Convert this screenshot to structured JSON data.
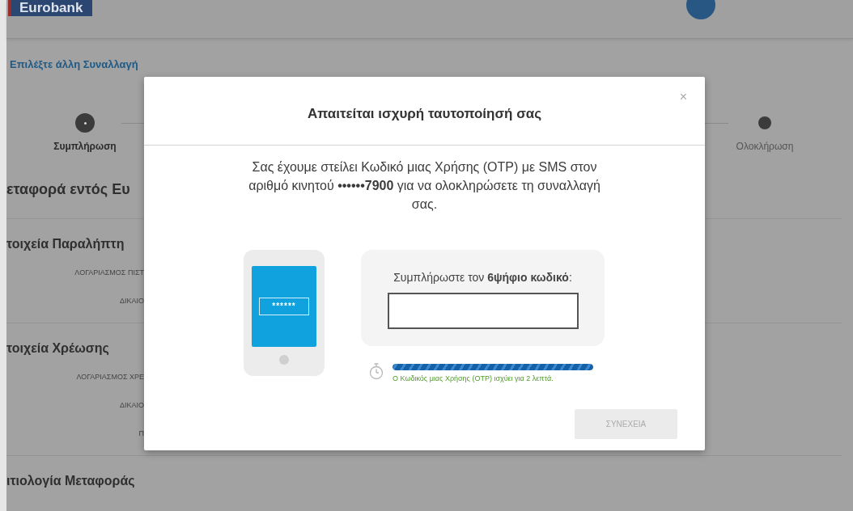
{
  "header": {
    "logo": "Eurobank"
  },
  "back_link": "Επιλέξτε άλλη Συναλλαγή",
  "steps": [
    {
      "label": "Συμπλήρωση",
      "current": true
    },
    {
      "label": "Ολοκλήρωση",
      "current": false
    }
  ],
  "page_title": "εταφορά εντός Ευ",
  "sections": [
    {
      "title": "τοιχεία Παραλήπτη",
      "fields": [
        "ΛΟΓΑΡΙΑΣΜΟΣ ΠΙΣΤ",
        "ΔΙΚΑΙΟ"
      ]
    },
    {
      "title": "τοιχεία Χρέωσης",
      "fields": [
        "ΛΟΓΑΡΙΑΣΜΟΣ ΧΡΕ",
        "ΔΙΚΑΙΟ",
        "Π"
      ]
    },
    {
      "title": "ιτιολογία Μεταφοράς"
    }
  ],
  "dialog": {
    "title": "Απαιτείται ισχυρή ταυτοποίησή σας",
    "close": "×",
    "message": "Σας έχουμε στείλει Κωδικό μιας Χρήσης (OTP) με SMS στον αριθμό κινητού **••••••7900** για να ολοκληρώσετε τη συναλλαγή σας.",
    "phone_screen": "******",
    "code_label": "Συμπλήρωστε τον **6ψήφιο κωδικό**:",
    "timer": {
      "level": 1,
      "note": "Ο Κωδικός μιας Χρήσης (OTP) ισχύει για 2 λεπτά."
    },
    "button": {
      "label": "ΣΥΝΕΧΕΙΑ",
      "disabled": true
    }
  }
}
